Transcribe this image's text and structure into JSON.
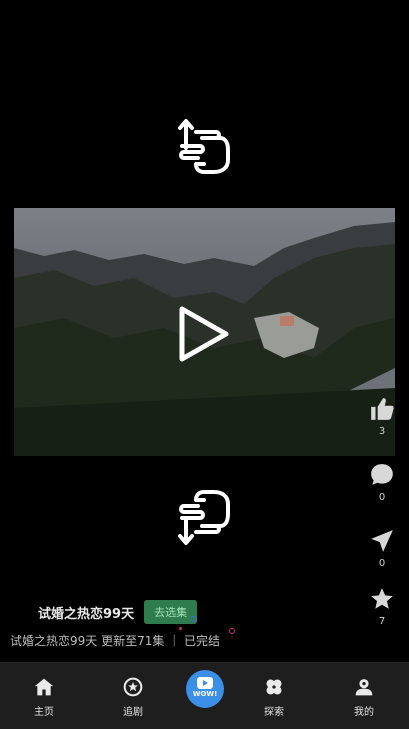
{
  "video": {
    "title": "试婚之热恋99天",
    "select_label": "去选集",
    "status": "试婚之热恋99天 更新至71集 ｜ 已完结"
  },
  "actions": {
    "like_count": "3",
    "comment_count": "0",
    "share_count": "0",
    "collect_count": "7"
  },
  "nav": {
    "home": "主页",
    "follow": "追剧",
    "wow": "WOW!",
    "explore": "探索",
    "mine": "我的"
  },
  "colors": {
    "accent_blue": "#3a8fe6",
    "select_green": "#2f7d4f",
    "bar_bg": "#1e1e1e"
  }
}
